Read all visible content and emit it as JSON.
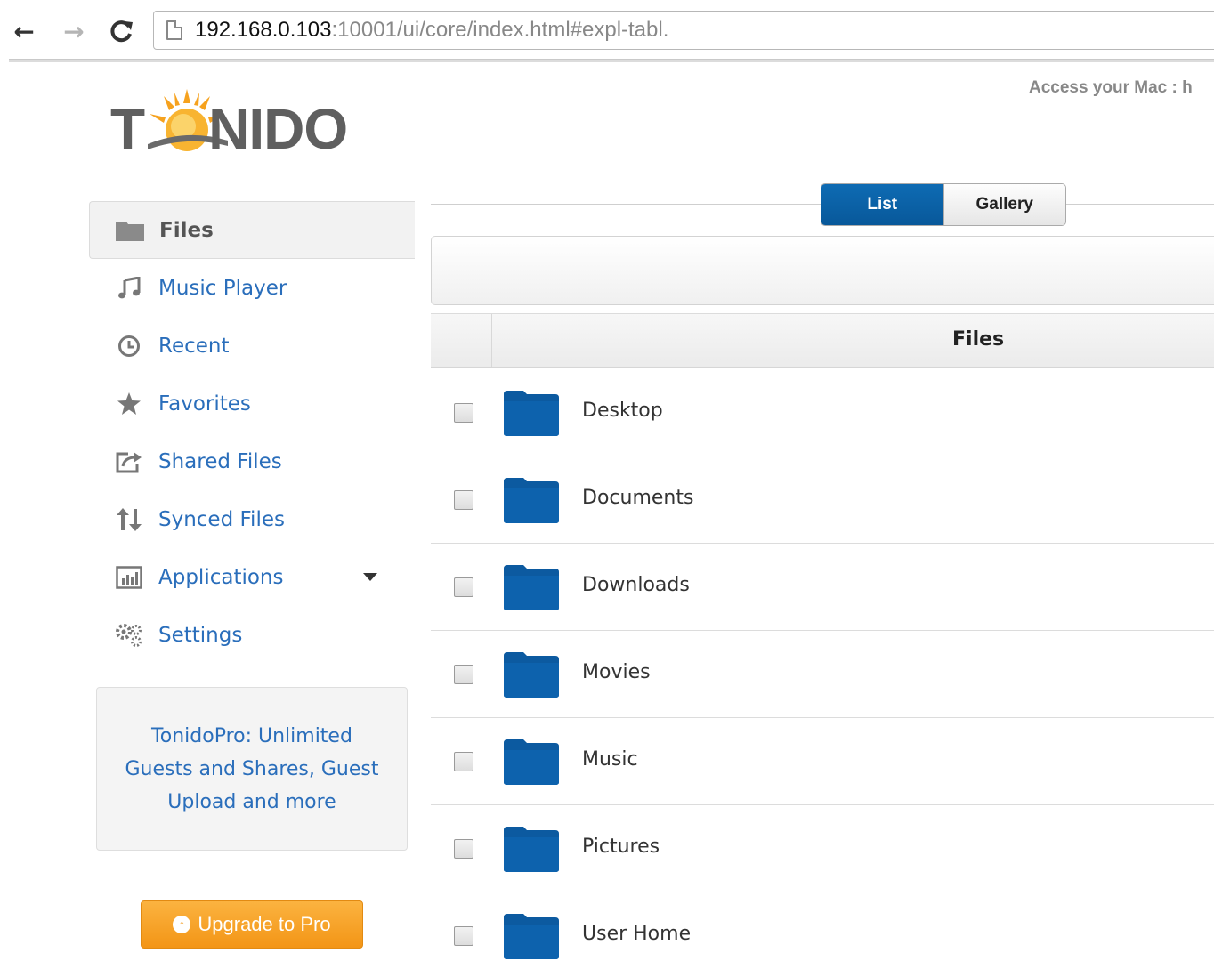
{
  "browser": {
    "url_host": "192.168.0.103",
    "url_rest": ":10001/ui/core/index.html#expl-tabl."
  },
  "header": {
    "access_text": "Access your Mac : h"
  },
  "logo": {
    "text_left": "T",
    "text_right": "NIDO",
    "brand_color": "#5f5f5f",
    "sun_color": "#f6a21e"
  },
  "sidebar": {
    "items": [
      {
        "label": "Files",
        "icon": "folder-icon",
        "active": true
      },
      {
        "label": "Music Player",
        "icon": "music-note-icon"
      },
      {
        "label": "Recent",
        "icon": "clock-icon"
      },
      {
        "label": "Favorites",
        "icon": "star-icon"
      },
      {
        "label": "Shared Files",
        "icon": "share-icon"
      },
      {
        "label": "Synced Files",
        "icon": "sync-icon"
      },
      {
        "label": "Applications",
        "icon": "bar-chart-icon"
      },
      {
        "label": "Settings",
        "icon": "gears-icon"
      }
    ],
    "promo_text": "TonidoPro: Unlimited Guests and Shares, Guest Upload and more",
    "upgrade_label": "Upgrade to Pro"
  },
  "view_toggle": {
    "list_label": "List",
    "gallery_label": "Gallery",
    "selected": "List",
    "accent_color": "#0b62a6"
  },
  "table": {
    "header": "Files",
    "rows": [
      {
        "name": "Desktop"
      },
      {
        "name": "Documents"
      },
      {
        "name": "Downloads"
      },
      {
        "name": "Movies"
      },
      {
        "name": "Music"
      },
      {
        "name": "Pictures"
      },
      {
        "name": "User Home"
      }
    ],
    "folder_color": "#0c5aa0"
  }
}
